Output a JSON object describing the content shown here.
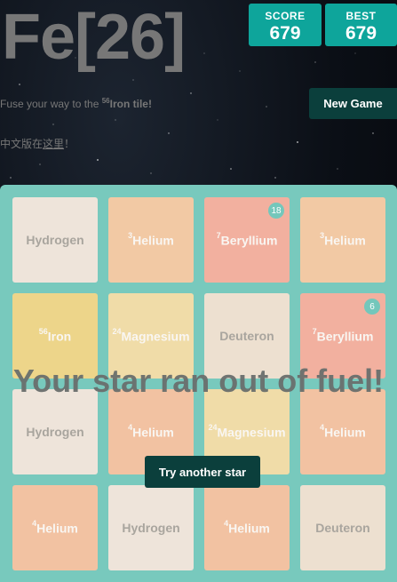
{
  "title": "Fe[26]",
  "scores": {
    "score_label": "SCORE",
    "score": "679",
    "best_label": "BEST",
    "best": "679"
  },
  "tagline": {
    "text": "Fuse your way to the ",
    "sup": "56",
    "element": "Iron tile!"
  },
  "new_game_label": "New Game",
  "chinese": {
    "prefix": "中文版在",
    "link": "这里",
    "suffix": "！"
  },
  "game_over": {
    "message": "Your star ran out of fuel!",
    "button": "Try another star"
  },
  "colors": {
    "board": "#78c9bd",
    "score_box": "#0ea59b",
    "button": "#0b3f3c",
    "hydrogen": "#eee4da",
    "deuteron": "#ede0d0",
    "helium": "#f2c8a2",
    "beryllium": "#f3b0a0",
    "magnesium": "#f0dca8",
    "iron": "#edd58a"
  },
  "tiles": [
    {
      "sup": "",
      "name": "Hydrogen",
      "color": "#eee4da",
      "light": true,
      "count": ""
    },
    {
      "sup": "3",
      "name": "Helium",
      "color": "#f2c9a4",
      "light": false,
      "count": ""
    },
    {
      "sup": "7",
      "name": "Beryllium",
      "color": "#f2b09f",
      "light": false,
      "count": "18"
    },
    {
      "sup": "3",
      "name": "Helium",
      "color": "#f2c9a4",
      "light": false,
      "count": ""
    },
    {
      "sup": "56",
      "name": "Iron",
      "color": "#edd58a",
      "light": false,
      "count": ""
    },
    {
      "sup": "24",
      "name": "Magnesium",
      "color": "#f0dca8",
      "light": false,
      "count": ""
    },
    {
      "sup": "",
      "name": "Deuteron",
      "color": "#ede0d0",
      "light": true,
      "count": ""
    },
    {
      "sup": "7",
      "name": "Beryllium",
      "color": "#f2b09f",
      "light": false,
      "count": "6"
    },
    {
      "sup": "",
      "name": "Hydrogen",
      "color": "#eee4da",
      "light": true,
      "count": ""
    },
    {
      "sup": "4",
      "name": "Helium",
      "color": "#f2c2a2",
      "light": false,
      "count": ""
    },
    {
      "sup": "24",
      "name": "Magnesium",
      "color": "#f0dca8",
      "light": false,
      "count": ""
    },
    {
      "sup": "4",
      "name": "Helium",
      "color": "#f2c2a2",
      "light": false,
      "count": ""
    },
    {
      "sup": "4",
      "name": "Helium",
      "color": "#f2c2a2",
      "light": false,
      "count": ""
    },
    {
      "sup": "",
      "name": "Hydrogen",
      "color": "#eee4da",
      "light": true,
      "count": ""
    },
    {
      "sup": "4",
      "name": "Helium",
      "color": "#f2c2a2",
      "light": false,
      "count": ""
    },
    {
      "sup": "",
      "name": "Deuteron",
      "color": "#ede0d0",
      "light": true,
      "count": ""
    }
  ]
}
